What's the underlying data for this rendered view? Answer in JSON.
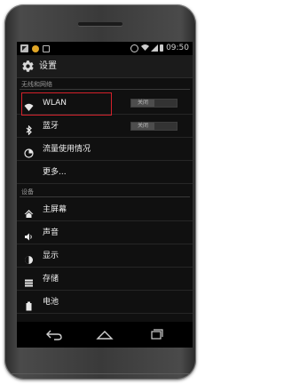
{
  "status_bar": {
    "time": "09:50",
    "icons": [
      "notification-icon",
      "app-notification-icon",
      "usb-icon",
      "alarm-icon",
      "wifi-icon",
      "signal-icon",
      "battery-icon"
    ]
  },
  "action_bar": {
    "title": "设置",
    "icon": "settings-gear-icon"
  },
  "sections": [
    {
      "header": "无线和网络",
      "items": [
        {
          "label": "WLAN",
          "icon": "wifi-icon",
          "toggle": "关闭"
        },
        {
          "label": "蓝牙",
          "icon": "bluetooth-icon",
          "toggle": "关闭"
        },
        {
          "label": "流量使用情况",
          "icon": "data-usage-icon"
        },
        {
          "label": "更多...",
          "icon": ""
        }
      ]
    },
    {
      "header": "设备",
      "items": [
        {
          "label": "主屏幕",
          "icon": "home-icon"
        },
        {
          "label": "声音",
          "icon": "sound-icon"
        },
        {
          "label": "显示",
          "icon": "display-icon"
        },
        {
          "label": "存储",
          "icon": "storage-icon"
        },
        {
          "label": "电池",
          "icon": "battery-icon"
        }
      ]
    }
  ],
  "nav_bar": [
    "back-icon",
    "home-icon",
    "recent-apps-icon"
  ],
  "colors": {
    "screen_bg": "#101010",
    "highlight_border": "#d4202a",
    "text": "#f0f0f0",
    "section_header": "#9a9a9a"
  }
}
